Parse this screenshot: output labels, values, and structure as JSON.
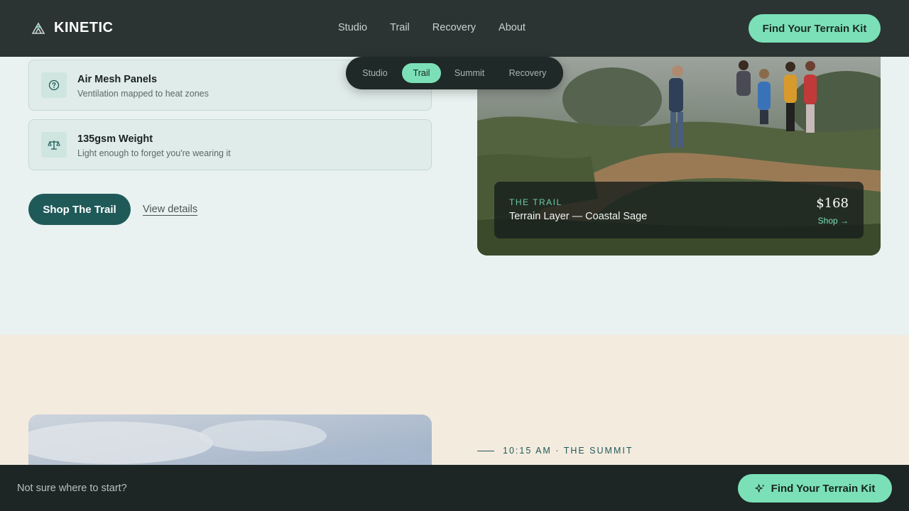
{
  "header": {
    "brand": "KINETIC",
    "nav": [
      "Studio",
      "Trail",
      "Recovery",
      "About"
    ],
    "cta": "Find Your Terrain Kit"
  },
  "tabs": {
    "items": [
      "Studio",
      "Trail",
      "Summit",
      "Recovery"
    ],
    "active": "Trail"
  },
  "features": [
    {
      "icon": "question-circle-icon",
      "title": "Air Mesh Panels",
      "subtitle": "Ventilation mapped to heat zones"
    },
    {
      "icon": "scale-icon",
      "title": "135gsm Weight",
      "subtitle": "Light enough to forget you're wearing it"
    }
  ],
  "actions": {
    "primary": "Shop The Trail",
    "secondary": "View details"
  },
  "product": {
    "eyebrow": "THE TRAIL",
    "name": "Terrain Layer — Coastal Sage",
    "price": "$168",
    "shop": "Shop →"
  },
  "summit": {
    "eyebrow": "10:15 AM · THE SUMMIT"
  },
  "bottom_bar": {
    "prompt": "Not sure where to start?",
    "cta": "Find Your Terrain Kit"
  },
  "colors": {
    "accent": "#7be0b8",
    "primary": "#1f5a59",
    "header_bg": "#2b3432"
  }
}
